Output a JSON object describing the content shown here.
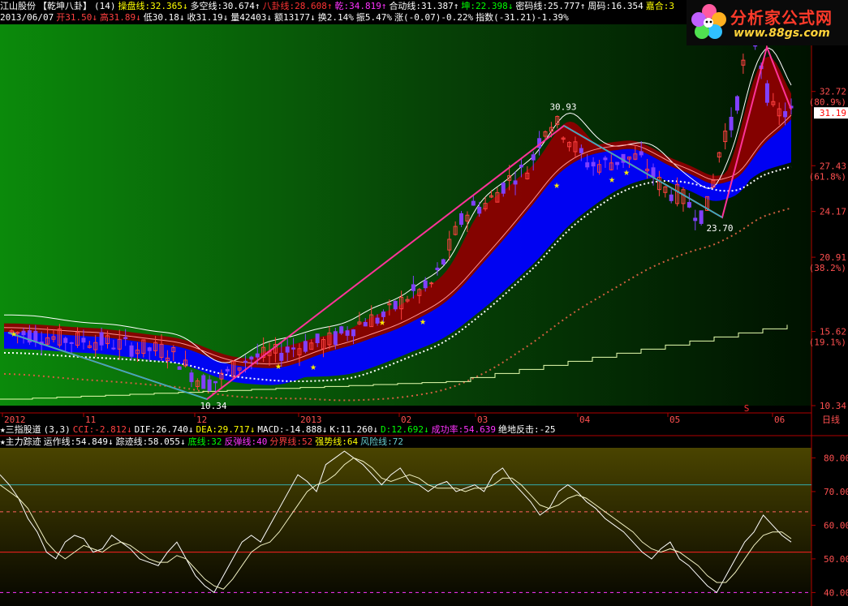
{
  "header": {
    "row1": [
      {
        "text": "江山股份",
        "color": "#ffffff"
      },
      {
        "text": "【乾坤八卦】",
        "color": "#ffffff"
      },
      {
        "text": "(14)",
        "color": "#ffffff"
      },
      {
        "text": "操盘线:32.365↓",
        "color": "#ffff00"
      },
      {
        "text": "多空线:30.674↑",
        "color": "#ffffff"
      },
      {
        "text": "八卦线:28.608↑",
        "color": "#ff3333"
      },
      {
        "text": "乾:34.819↑",
        "color": "#ff33ff"
      },
      {
        "text": "合动线:31.387↑",
        "color": "#ffffff"
      },
      {
        "text": "坤:22.398↓",
        "color": "#00ff00"
      },
      {
        "text": "密码线:25.777↑",
        "color": "#ffffff"
      },
      {
        "text": "周码:16.354",
        "color": "#ffffff"
      },
      {
        "text": "嘉合:3",
        "color": "#ffff00"
      }
    ],
    "row2": [
      {
        "text": "2013/06/07",
        "color": "#ffffff"
      },
      {
        "text": "开31.50↓",
        "color": "#ff4040"
      },
      {
        "text": "高31.89↓",
        "color": "#ff4040"
      },
      {
        "text": "低30.18↓",
        "color": "#ffffff"
      },
      {
        "text": "收31.19↓",
        "color": "#ffffff"
      },
      {
        "text": "量42403↓",
        "color": "#ffffff"
      },
      {
        "text": "额13177↓",
        "color": "#ffffff"
      },
      {
        "text": "换2.14%",
        "color": "#ffffff"
      },
      {
        "text": "振5.47%",
        "color": "#ffffff"
      },
      {
        "text": "涨(-0.07)-0.22%",
        "color": "#ffffff"
      },
      {
        "text": "指数(-31.21)-1.39%",
        "color": "#ffffff"
      }
    ]
  },
  "logo": {
    "text": "分析家公式网",
    "url": "www.88gs.com"
  },
  "indicator_header": [
    {
      "text": "★三指股道",
      "color": "#ffffff"
    },
    {
      "text": "(3,3)",
      "color": "#ffffff"
    },
    {
      "text": "CCI:-2.812↓",
      "color": "#ff4040"
    },
    {
      "text": "DIF:26.740↓",
      "color": "#ffffff"
    },
    {
      "text": "DEA:29.717↓",
      "color": "#ffff00"
    },
    {
      "text": "MACD:-14.888↓",
      "color": "#ffffff"
    },
    {
      "text": "K:11.260↓",
      "color": "#ffffff"
    },
    {
      "text": "D:12.692↓",
      "color": "#00ff00"
    },
    {
      "text": "成功率:54.639",
      "color": "#ff33ff"
    },
    {
      "text": "绝地反击:-25",
      "color": "#ffffff"
    }
  ],
  "sub_header": [
    {
      "text": "★主力踪迹",
      "color": "#ffffff"
    },
    {
      "text": "运作线:54.849↓",
      "color": "#ffffff"
    },
    {
      "text": "踪迹线:58.055↓",
      "color": "#ffffff"
    },
    {
      "text": "底线:32",
      "color": "#00ff00"
    },
    {
      "text": "反弹线:40",
      "color": "#ff33ff"
    },
    {
      "text": "分界线:52",
      "color": "#ff4040"
    },
    {
      "text": "强势线:64",
      "color": "#ffff00"
    },
    {
      "text": "风险线:72",
      "color": "#66cccc"
    }
  ],
  "chart_data": [
    {
      "type": "line",
      "x_ticks": [
        "2012",
        "11",
        "12",
        "2013",
        "02",
        "03",
        "04",
        "05",
        "06"
      ],
      "x_axis_label": "日线",
      "y_ticks": [
        {
          "value": 32.72,
          "label": "32.72",
          "pct": "(80.9%)"
        },
        {
          "value": 27.43,
          "label": "27.43",
          "pct": "(61.8%)"
        },
        {
          "value": 24.17,
          "label": "24.17",
          "pct": ""
        },
        {
          "value": 20.91,
          "label": "20.91",
          "pct": "(38.2%)"
        },
        {
          "value": 15.62,
          "label": "15.62",
          "pct": "(19.1%)"
        },
        {
          "value": 10.34,
          "label": "10.34",
          "pct": ""
        }
      ],
      "ylim": [
        10.34,
        37.5
      ],
      "last_price": {
        "value": 31.19,
        "label": "31.19"
      },
      "annotations": [
        {
          "label": "30.93",
          "value": 30.93,
          "x_fraction": 0.694
        },
        {
          "label": "23.70",
          "value": 23.7,
          "x_fraction": 0.887
        },
        {
          "label": "10.34",
          "value": 10.34,
          "x_fraction": 0.263
        }
      ],
      "signal_marker": "S",
      "colors": {
        "bull": "#ff4040",
        "bear": "#8040ff",
        "band_upper": "#8b0000",
        "band_lower": "#0000ff"
      }
    },
    {
      "type": "line",
      "y_ticks": [
        80,
        70,
        60,
        50,
        40
      ],
      "ylim": [
        36,
        83
      ],
      "levels": [
        {
          "name": "底线",
          "value": 32,
          "color": "#00ff00"
        },
        {
          "name": "反弹线",
          "value": 40,
          "color": "#ff33ff"
        },
        {
          "name": "分界线",
          "value": 52,
          "color": "#ff2020"
        },
        {
          "name": "强势线",
          "value": 64,
          "color": "#ff6060"
        },
        {
          "name": "风险线",
          "value": 72,
          "color": "#33aaaa"
        }
      ],
      "series": [
        {
          "name": "运作线",
          "values": [
            75,
            72,
            68,
            62,
            58,
            52,
            50,
            55,
            57,
            56,
            52,
            53,
            57,
            55,
            53,
            50,
            49,
            48,
            52,
            55,
            50,
            45,
            42,
            40,
            45,
            50,
            55,
            57,
            55,
            60,
            65,
            70,
            75,
            73,
            70,
            78,
            80,
            82,
            80,
            78,
            75,
            72,
            75,
            77,
            73,
            72,
            70,
            72,
            73,
            70,
            71,
            72,
            70,
            75,
            77,
            73,
            70,
            67,
            63,
            65,
            70,
            72,
            70,
            67,
            65,
            62,
            60,
            58,
            55,
            52,
            50,
            53,
            55,
            50,
            48,
            45,
            42,
            40,
            45,
            50,
            55,
            58,
            63,
            60,
            57,
            55
          ]
        },
        {
          "name": "踪迹线",
          "values": [
            72,
            70,
            68,
            65,
            60,
            55,
            52,
            50,
            52,
            54,
            53,
            52,
            54,
            55,
            54,
            52,
            50,
            49,
            49,
            51,
            50,
            47,
            44,
            42,
            41,
            44,
            48,
            52,
            54,
            55,
            58,
            62,
            66,
            70,
            72,
            73,
            75,
            78,
            80,
            79,
            77,
            74,
            73,
            74,
            75,
            74,
            72,
            71,
            71,
            71,
            70,
            71,
            71,
            72,
            74,
            74,
            72,
            69,
            66,
            65,
            66,
            68,
            69,
            68,
            66,
            64,
            62,
            60,
            58,
            55,
            53,
            52,
            53,
            52,
            50,
            48,
            45,
            43,
            43,
            46,
            50,
            54,
            57,
            58,
            58,
            56
          ]
        }
      ]
    }
  ]
}
